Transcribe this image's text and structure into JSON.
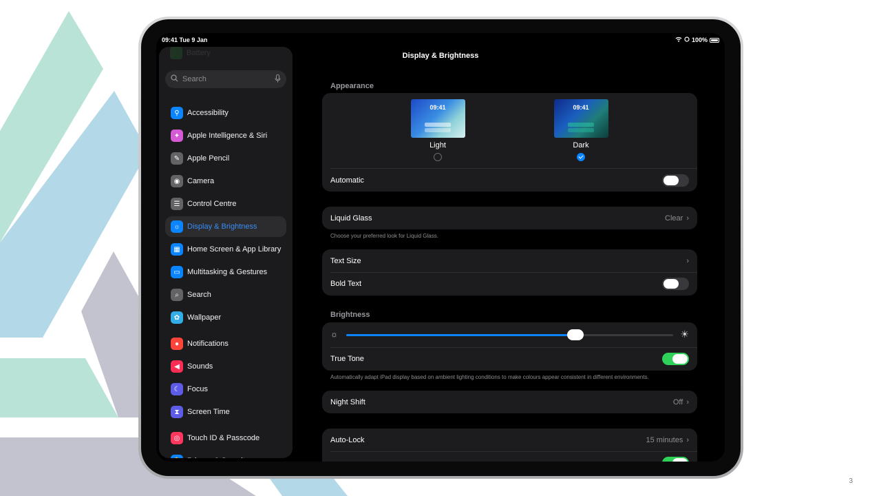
{
  "slide_number": "3",
  "status_bar": {
    "time_date": "09:41  Tue 9 Jan",
    "battery": "100%"
  },
  "sidebar": {
    "faded_item": "Battery",
    "search_placeholder": "Search",
    "items": [
      {
        "label": "Accessibility",
        "icon": "accessibility-icon",
        "color": "#0a84ff"
      },
      {
        "label": "Apple Intelligence & Siri",
        "icon": "siri-icon",
        "color": "#d45bd4"
      },
      {
        "label": "Apple Pencil",
        "icon": "pencil-icon",
        "color": "#636366"
      },
      {
        "label": "Camera",
        "icon": "camera-icon",
        "color": "#636366"
      },
      {
        "label": "Control Centre",
        "icon": "control-centre-icon",
        "color": "#636366"
      },
      {
        "label": "Display & Brightness",
        "icon": "brightness-icon",
        "color": "#0a84ff",
        "active": true
      },
      {
        "label": "Home Screen & App Library",
        "icon": "home-screen-icon",
        "color": "#0a84ff"
      },
      {
        "label": "Multitasking & Gestures",
        "icon": "multitasking-icon",
        "color": "#0a84ff"
      },
      {
        "label": "Search",
        "icon": "search-icon",
        "color": "#636366"
      },
      {
        "label": "Wallpaper",
        "icon": "wallpaper-icon",
        "color": "#32ade6"
      },
      {
        "label": "Notifications",
        "icon": "notifications-icon",
        "color": "#ff453a"
      },
      {
        "label": "Sounds",
        "icon": "sounds-icon",
        "color": "#ff2d55"
      },
      {
        "label": "Focus",
        "icon": "focus-icon",
        "color": "#5e5ce6"
      },
      {
        "label": "Screen Time",
        "icon": "hourglass-icon",
        "color": "#5e5ce6"
      },
      {
        "label": "Touch ID & Passcode",
        "icon": "fingerprint-icon",
        "color": "#ff375f"
      },
      {
        "label": "Privacy & Security",
        "icon": "hand-icon",
        "color": "#0a84ff"
      }
    ]
  },
  "main": {
    "title": "Display & Brightness",
    "appearance": {
      "header": "Appearance",
      "light_label": "Light",
      "dark_label": "Dark",
      "thumb_time": "09:41",
      "selected": "Dark",
      "automatic_label": "Automatic",
      "automatic_on": false
    },
    "liquid_glass": {
      "label": "Liquid Glass",
      "value": "Clear",
      "footnote": "Choose your preferred look for Liquid Glass."
    },
    "text_size_label": "Text Size",
    "bold_text": {
      "label": "Bold Text",
      "on": false
    },
    "brightness": {
      "header": "Brightness",
      "level": 0.7,
      "true_tone_label": "True Tone",
      "true_tone_on": true,
      "footnote": "Automatically adapt iPad display based on ambient lighting conditions to make colours appear consistent in different environments."
    },
    "night_shift": {
      "label": "Night Shift",
      "value": "Off"
    },
    "auto_lock": {
      "label": "Auto-Lock",
      "value": "15 minutes"
    }
  },
  "colors": {
    "accent": "#0a84ff",
    "toggle_on": "#30d158",
    "bg_teal": "#b9e3d6",
    "bg_blue": "#b3d8e8",
    "bg_gray": "#c3c3cf"
  }
}
